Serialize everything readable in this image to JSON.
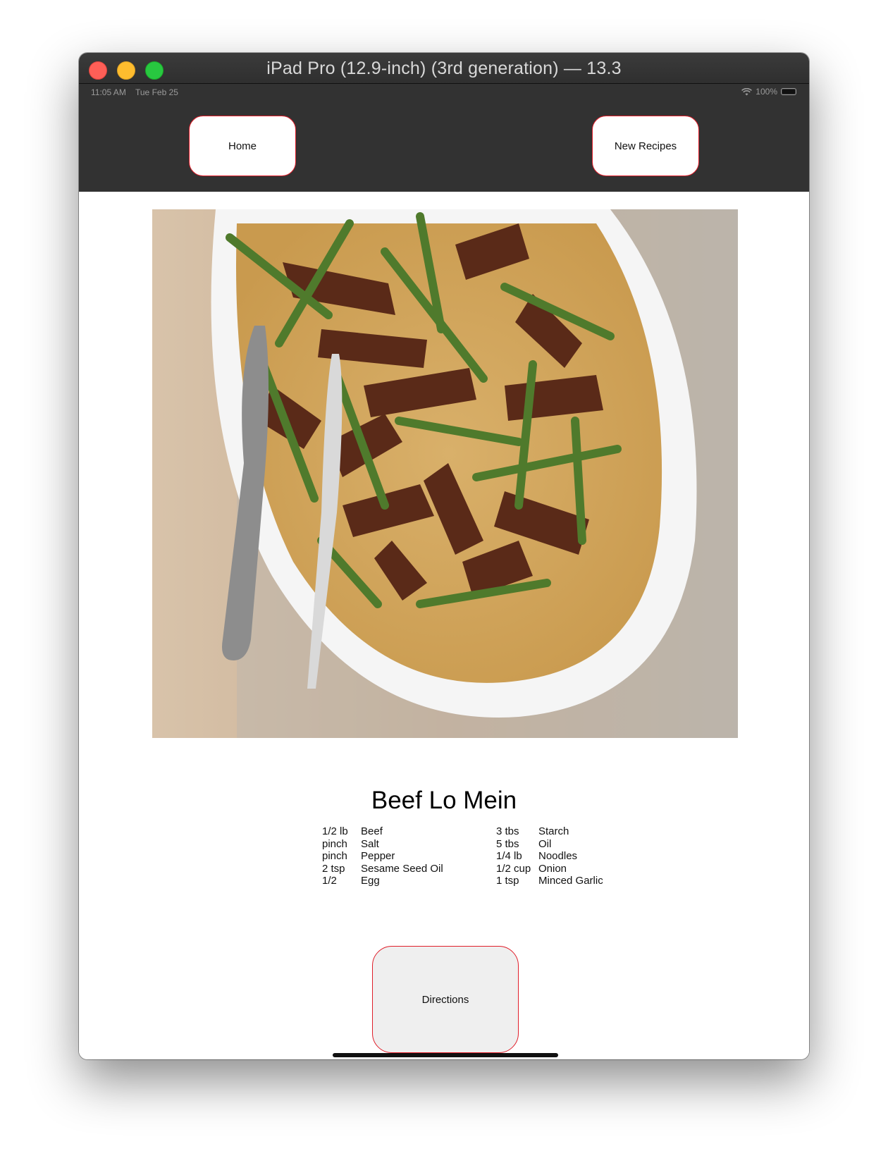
{
  "window": {
    "title": "iPad Pro (12.9-inch) (3rd generation) — 13.3"
  },
  "status_bar": {
    "time": "11:05 AM",
    "date": "Tue Feb 25",
    "battery": "100%",
    "icons": [
      "wifi-icon",
      "battery-icon"
    ]
  },
  "nav": {
    "home_label": "Home",
    "new_recipes_label": "New Recipes"
  },
  "recipe": {
    "title": "Beef Lo Mein",
    "ingredients_left": [
      {
        "qty": "1/2 lb",
        "item": "Beef"
      },
      {
        "qty": "pinch",
        "item": "Salt"
      },
      {
        "qty": "pinch",
        "item": "Pepper"
      },
      {
        "qty": "2 tsp",
        "item": "Sesame Seed Oil"
      },
      {
        "qty": "1/2",
        "item": "Egg"
      }
    ],
    "ingredients_right": [
      {
        "qty": "3 tbs",
        "item": "Starch"
      },
      {
        "qty": "5 tbs",
        "item": "Oil"
      },
      {
        "qty": "1/4 lb",
        "item": "Noodles"
      },
      {
        "qty": "1/2 cup",
        "item": "Onion"
      },
      {
        "qty": "1 tsp",
        "item": "Minced Garlic"
      }
    ]
  },
  "actions": {
    "directions_label": "Directions"
  },
  "colors": {
    "nav_background": "#323232",
    "button_border": "#e01e2a",
    "button_fill": "#ffffff",
    "directions_fill": "#efefef"
  }
}
